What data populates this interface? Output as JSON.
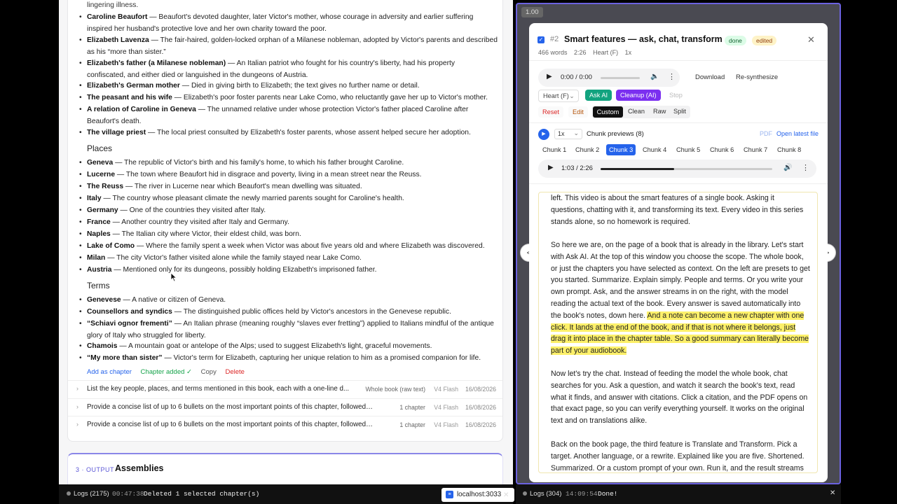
{
  "left": {
    "top_fragment": "lingering illness.",
    "people": [
      {
        "name": "Caroline Beaufort",
        "desc": " — Beaufort's devoted daughter, later Victor's mother, whose courage in adversity and earlier suffering",
        "desc2": "inspired her husband's protective love and her own charity toward the poor."
      },
      {
        "name": "Elizabeth Lavenza",
        "desc": " — The fair-haired, golden-locked orphan of a Milanese nobleman, adopted by Victor's parents and described",
        "desc2": "as his “more than sister.”"
      },
      {
        "name": "Elizabeth's father (a Milanese nobleman)",
        "desc": " — An Italian patriot who fought for his country's liberty, had his property",
        "desc2": "confiscated, and either died or languished in the dungeons of Austria."
      },
      {
        "name": "Elizabeth's German mother",
        "desc": " — Died in giving birth to Elizabeth; the text gives no further name or detail.",
        "desc2": ""
      },
      {
        "name": "The peasant and his wife",
        "desc": " — Elizabeth's poor foster parents near Lake Como, who reluctantly gave her up to Victor's mother.",
        "desc2": ""
      },
      {
        "name": "A relation of Caroline in Geneva",
        "desc": " — The unnamed relative under whose protection Victor's father placed Caroline after",
        "desc2": "Beaufort's death."
      },
      {
        "name": "The village priest",
        "desc": " — The local priest consulted by Elizabeth's foster parents, whose assent helped secure her adoption.",
        "desc2": ""
      }
    ],
    "places_heading": "Places",
    "places": [
      {
        "name": "Geneva",
        "desc": " — The republic of Victor's birth and his family's home, to which his father brought Caroline."
      },
      {
        "name": "Lucerne",
        "desc": " — The town where Beaufort hid in disgrace and poverty, living in a mean street near the Reuss."
      },
      {
        "name": "The Reuss",
        "desc": " — The river in Lucerne near which Beaufort's mean dwelling was situated."
      },
      {
        "name": "Italy",
        "desc": " — The country whose pleasant climate the newly married parents sought for Caroline's health."
      },
      {
        "name": "Germany",
        "desc": " — One of the countries they visited after Italy."
      },
      {
        "name": "France",
        "desc": " — Another country they visited after Italy and Germany."
      },
      {
        "name": "Naples",
        "desc": " — The Italian city where Victor, their eldest child, was born."
      },
      {
        "name": "Lake of Como",
        "desc": " — Where the family spent a week when Victor was about five years old and where Elizabeth was discovered."
      },
      {
        "name": "Milan",
        "desc": " — The city Victor's father visited alone while the family stayed near Lake Como."
      },
      {
        "name": "Austria",
        "desc": " — Mentioned only for its dungeons, possibly holding Elizabeth's imprisoned father."
      }
    ],
    "terms_heading": "Terms",
    "terms": [
      {
        "name": "Genevese",
        "desc": " — A native or citizen of Geneva.",
        "desc2": ""
      },
      {
        "name": "Counsellors and syndics",
        "desc": " — The distinguished public offices held by Victor's ancestors in the Genevese republic.",
        "desc2": ""
      },
      {
        "name": "“Schiavi ognor frementi”",
        "desc": " — An Italian phrase (meaning roughly “slaves ever fretting”) applied to Italians mindful of the antique",
        "desc2": "glory of Italy who struggled for liberty."
      },
      {
        "name": "Chamois",
        "desc": " — A mountain goat or antelope of the Alps; used to suggest Elizabeth's light, graceful movements.",
        "desc2": ""
      },
      {
        "name": "“My more than sister”",
        "desc": " — Victor's term for Elizabeth, capturing her unique relation to him as a promised companion for life.",
        "desc2": ""
      }
    ],
    "actions": {
      "add": "Add as chapter",
      "added": "Chapter added ✓",
      "copy": "Copy",
      "delete": "Delete"
    },
    "history": [
      {
        "q": "List the key people, places, and terms mentioned in this book, each with a one-line d...",
        "scope": "Whole book (raw text)",
        "model": "V4 Flash",
        "date": "16/08/2026"
      },
      {
        "q": "Provide a concise list of up to 6 bullets on the most important points of this chapter, followed by...",
        "scope": "1 chapter",
        "model": "V4 Flash",
        "date": "16/08/2026"
      },
      {
        "q": "Provide a concise list of up to 6 bullets on the most important points of this chapter, followed by...",
        "scope": "1 chapter",
        "model": "V4 Flash",
        "date": "16/08/2026"
      }
    ],
    "output_step": "3 · OUTPUT",
    "output_title": "Assemblies"
  },
  "status_left": {
    "logs": "Logs (2175)",
    "time": "00:47:38",
    "msg": "Deleted 1 selected chapter(s)",
    "host": "localhost:3033"
  },
  "status_right": {
    "logs": "Logs (304)",
    "time": "14:09:54",
    "msg": "Done!"
  },
  "zoom": "1.00",
  "modal": {
    "index": "#2",
    "title": "Smart features — ask, chat, transform",
    "badge_done": "done",
    "badge_edited": "edited",
    "meta": {
      "words": "466 words",
      "duration": "2:26",
      "voice": "Heart (F)",
      "speed": "1x"
    },
    "player": {
      "time": "0:00 / 0:00",
      "download": "Download",
      "resynth": "Re-synthesize"
    },
    "voice_select": "Heart (F)",
    "ask_ai": "Ask AI",
    "cleanup": "Cleanup (AI)",
    "stop": "Stop",
    "reset": "Reset",
    "edit": "Edit",
    "modes": [
      "Custom",
      "Clean",
      "Raw",
      "Split"
    ],
    "chunk_speed": "1x",
    "chunk_label": "Chunk previews (8)",
    "pdf": "PDF",
    "open_latest": "Open latest file",
    "chunks": [
      "Chunk 1",
      "Chunk 2",
      "Chunk 3",
      "Chunk 4",
      "Chunk 5",
      "Chunk 6",
      "Chunk 7",
      "Chunk 8"
    ],
    "chunk_player_time": "1:03 / 2:26",
    "chunk_progress": 0.43,
    "text": {
      "p1": "left. This video is about the smart features of a single book. Asking it questions, chatting with it, and transforming its text. Every video in this series stands alone, so no homework is required.",
      "p2a": "So here we are, on the page of a book that is already in the library. Let's start with Ask AI. At the top of this window you choose the scope. The whole book, or just the chapters you have selected as context. On the left are presets to get you started. Summarize. Explain simply. People and terms. Or you write your own prompt. Ask, and the answer streams in on the right, with the model reading the actual text of the book. Every answer is saved automatically into the book's notes, down here. ",
      "p2b": "And a note can become a new chapter with one click. It lands at the end of the book, and if that is not where it belongs, just drag it into place in the chapter table. So a good summary can literally become part of your audiobook.",
      "p3": "Now let's try the chat. Instead of feeding the model the whole book, chat searches for you. Ask a question, and watch it search the book's text, read what it finds, and answer with citations. Click a citation, and the PDF opens on that exact page, so you can verify everything yourself. It works on the original text and on translations alike.",
      "p4": "Back on the book page, the third feature is Translate and Transform. Pick a target. Another language, or a rewrite. Explained like you are five. Shortened. Summarized. Or a custom prompt of your own. Run it, and the result streams"
    }
  },
  "colors": {
    "accent": "#2563eb",
    "ask": "#12a37f",
    "cleanup": "#7b2ff0",
    "highlight": "#fdf06a",
    "border_active": "#6b62e0"
  }
}
